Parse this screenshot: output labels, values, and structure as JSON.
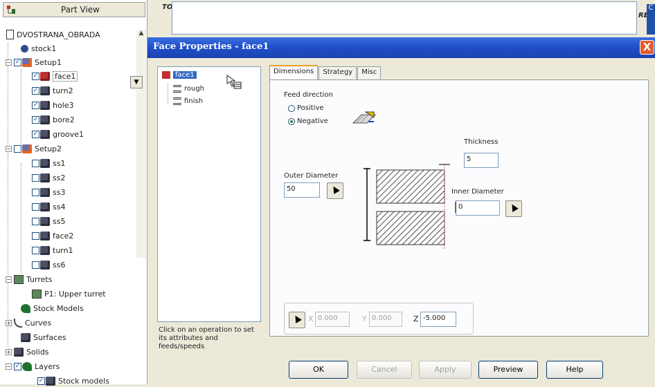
{
  "part_view": {
    "title": "Part View",
    "root": "DVOSTRANA_OBRADA",
    "items": {
      "stock1": "stock1",
      "setup1": "Setup1",
      "face1": "face1",
      "turn2": "turn2",
      "hole3": "hole3",
      "bore2": "bore2",
      "groove1": "groove1",
      "setup2": "Setup2",
      "ss1": "ss1",
      "ss2": "ss2",
      "ss3": "ss3",
      "ss4": "ss4",
      "ss5": "ss5",
      "face2": "face2",
      "turn1": "turn1",
      "ss6": "ss6",
      "turrets": "Turrets",
      "p1": "P1: Upper turret",
      "stock_models": "Stock Models",
      "curves": "Curves",
      "surfaces": "Surfaces",
      "solids": "Solids",
      "layers": "Layers",
      "stock_models_layer": "Stock models"
    }
  },
  "top_strip": {
    "left_label": "TO",
    "right_label": "RE",
    "right_blue": "C"
  },
  "dialog": {
    "title": "Face Properties - face1",
    "close": "X",
    "operations": {
      "face1": "face1",
      "rough": "rough",
      "finish": "finish"
    },
    "hint": "Click on an operation to set its attributes and feeds/speeds",
    "tabs": [
      "Dimensions",
      "Strategy",
      "Misc"
    ],
    "feed_direction_label": "Feed direction",
    "positive": "Positive",
    "negative": "Negative",
    "thickness_label": "Thickness",
    "thickness_value": "5",
    "outer_diameter_label": "Outer Diameter",
    "outer_diameter_value": "50",
    "inner_diameter_label": "Inner Diameter",
    "inner_diameter_value": "0",
    "x_label": "X",
    "x_value": "0.000",
    "y_label": "Y",
    "y_value": "0.000",
    "z_label": "Z",
    "z_value": "-5.000",
    "buttons": {
      "ok": "OK",
      "cancel": "Cancel",
      "apply": "Apply",
      "preview": "Preview",
      "help": "Help"
    }
  },
  "colors": {
    "title_bar": "#1f4fc8",
    "close_button": "#e35b2c",
    "selection": "#316ac5",
    "tab_highlight": "#e8a02c"
  }
}
